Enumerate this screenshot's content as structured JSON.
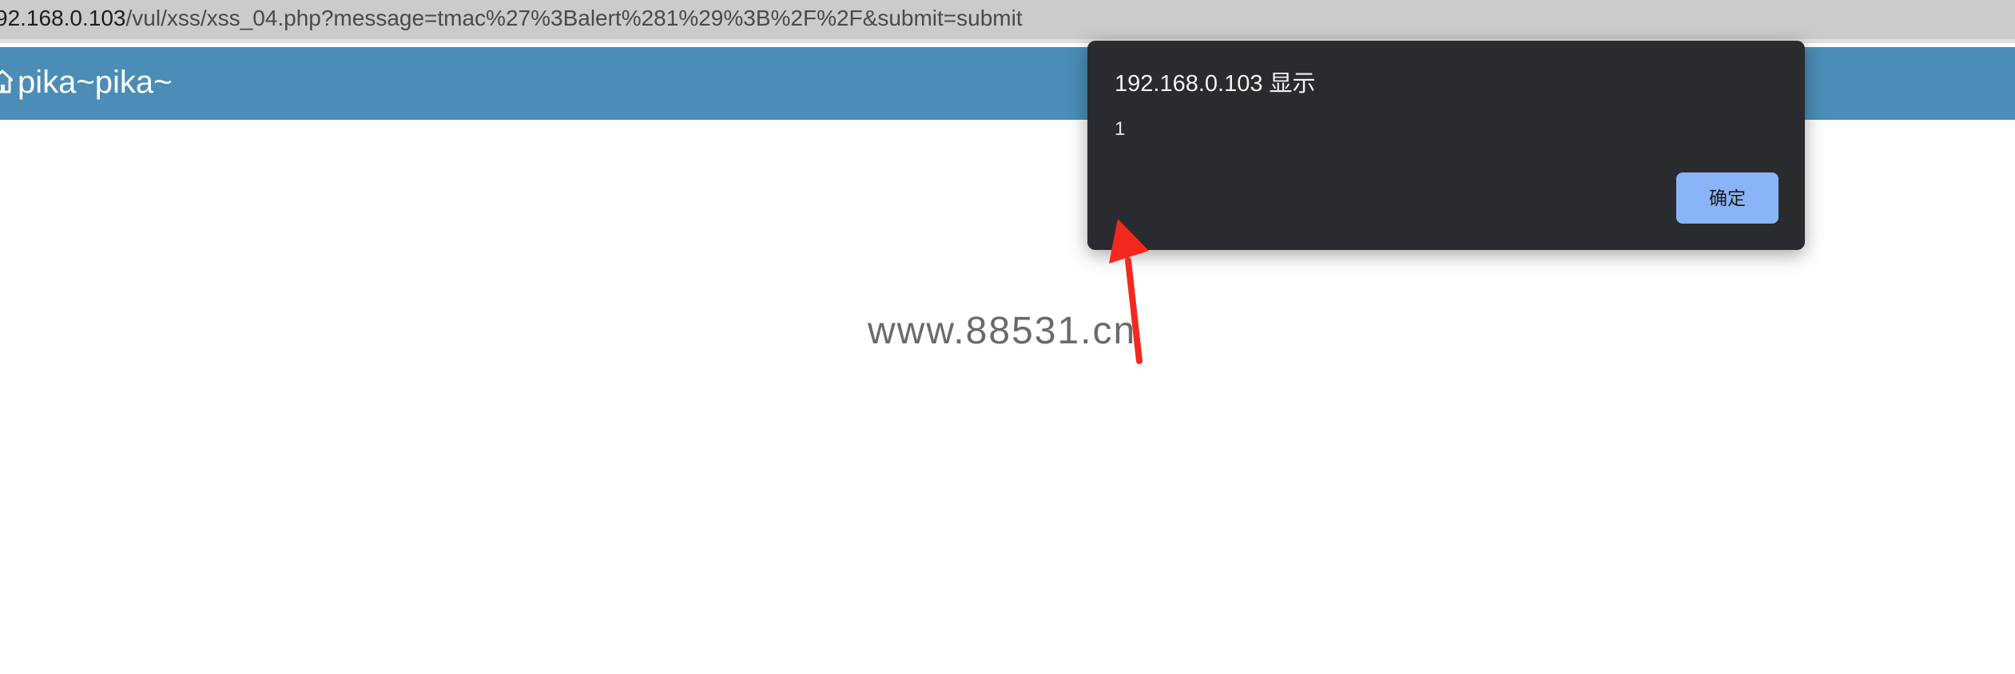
{
  "address_bar": {
    "host": "92.168.0.103",
    "path": "/vul/xss/xss_04.php?message=tmac%27%3Balert%281%29%3B%2F%2F&submit=submit"
  },
  "navbar": {
    "brand": "pika~pika~",
    "home_icon": "home-icon"
  },
  "watermark": "www.88531.cn",
  "dialog": {
    "title": "192.168.0.103 显示",
    "message": "1",
    "ok_label": "确定"
  },
  "colors": {
    "navbar": "#4b8db6",
    "dialog_bg": "#2a2b2f",
    "ok_button": "#8ab4f8",
    "arrow": "#f4281e"
  }
}
